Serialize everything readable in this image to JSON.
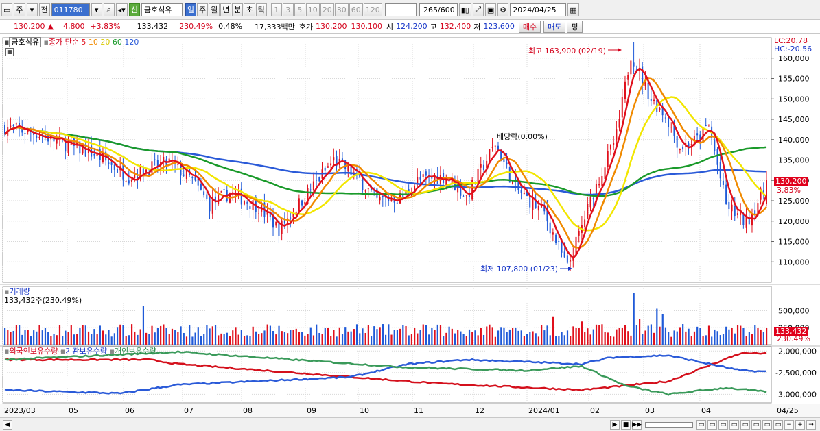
{
  "toolbar": {
    "mode": "주",
    "prev": "전",
    "code": "011780",
    "company": "금호석유",
    "new_badge": "신",
    "periods": [
      "일",
      "주",
      "월",
      "년",
      "분",
      "초",
      "틱"
    ],
    "nums": [
      "1",
      "3",
      "5",
      "10",
      "20",
      "30",
      "60",
      "120"
    ],
    "count": "265",
    "count_total": "/600",
    "date": "2024/04/25"
  },
  "quote": {
    "price": "130,200",
    "change_arrow": "▲",
    "change": "4,800",
    "change_pct": "+3.83%",
    "volume": "133,432",
    "volume_ratio": "230.49%",
    "turnover": "0.48%",
    "amount": "17,333백만",
    "ask_label": "호가",
    "ask": "130,200",
    "bid": "130,100",
    "open_label": "시",
    "open": "124,200",
    "high_label": "고",
    "high": "132,400",
    "low_label": "저",
    "low": "123,600",
    "buy": "매수",
    "sell": "매도",
    "eval": "평"
  },
  "legend": {
    "name": "금호석유",
    "ma_title": "종가 단순",
    "ma5": "5",
    "ma10": "10",
    "ma20": "20",
    "ma60": "60",
    "ma120": "120",
    "lc": "LC:20.78",
    "hc": "HC:-20.56"
  },
  "annotations": {
    "high": "최고 163,900 (02/19)",
    "low": "최저 107,800 (01/23)",
    "dividend": "배당락(0.00%)",
    "last_price": "130,200",
    "last_pct": "3.83%"
  },
  "volume_panel": {
    "title": "거래량",
    "value": "133,432주(230.49%)",
    "box_value": "133,432",
    "box_pct": "230.49%",
    "ticks": [
      "500,000",
      "250,000"
    ]
  },
  "holdings_panel": {
    "foreign": "외국인보유수량",
    "inst": "기관보유수량",
    "retail": "개인보유수량",
    "ticks": [
      "-2,000,000",
      "-2,500,000",
      "-3,000,000"
    ]
  },
  "price_ticks": [
    "160,000",
    "155,000",
    "150,000",
    "145,000",
    "140,000",
    "135,000",
    "130,000",
    "125,000",
    "120,000",
    "115,000",
    "110,000"
  ],
  "x_ticks": [
    "2023/03",
    "05",
    "06",
    "07",
    "08",
    "09",
    "10",
    "11",
    "12",
    "2024/01",
    "02",
    "03",
    "04",
    "04/25"
  ],
  "colors": {
    "ma5": "#e0101c",
    "ma10": "#f08a00",
    "ma20": "#f2e600",
    "ma60": "#1a9a2a",
    "ma120": "#2a5ad8",
    "up": "#e0101c",
    "down": "#1f5ad8"
  },
  "chart_data": {
    "type": "candlestick",
    "ylim": [
      105000,
      165000
    ],
    "high": 163900,
    "low": 107800,
    "last": 130200,
    "holdings_ylim": [
      -3200000,
      -1900000
    ]
  }
}
